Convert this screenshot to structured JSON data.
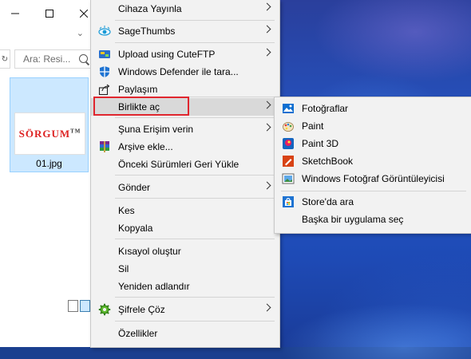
{
  "explorer": {
    "search_placeholder": "Ara: Resi...",
    "file_name": "01.jpg",
    "thumbnail_logo": "SÖRGUM",
    "thumbnail_logo_mark": "TM"
  },
  "context_menu": {
    "items": [
      {
        "label": "Cihaza Yayınla",
        "icon": "",
        "has_submenu": true
      },
      {
        "label": "SageThumbs",
        "icon": "eye-icon",
        "has_submenu": true
      },
      {
        "label": "Upload using CuteFTP",
        "icon": "cuteftp-icon",
        "has_submenu": true
      },
      {
        "label": "Windows Defender ile tara...",
        "icon": "defender-shield-icon",
        "has_submenu": false
      },
      {
        "label": "Paylaşım",
        "icon": "share-icon",
        "has_submenu": false
      },
      {
        "label": "Birlikte aç",
        "icon": "",
        "has_submenu": true,
        "highlighted": true
      },
      {
        "label": "Şuna Erişim verin",
        "icon": "",
        "has_submenu": true
      },
      {
        "label": "Arşive ekle...",
        "icon": "winrar-icon",
        "has_submenu": false
      },
      {
        "label": "Önceki Sürümleri Geri Yükle",
        "icon": "",
        "has_submenu": false
      },
      {
        "label": "Gönder",
        "icon": "",
        "has_submenu": true
      },
      {
        "label": "Kes",
        "icon": "",
        "has_submenu": false
      },
      {
        "label": "Kopyala",
        "icon": "",
        "has_submenu": false
      },
      {
        "label": "Kısayol oluştur",
        "icon": "",
        "has_submenu": false
      },
      {
        "label": "Sil",
        "icon": "",
        "has_submenu": false
      },
      {
        "label": "Yeniden adlandır",
        "icon": "",
        "has_submenu": false
      },
      {
        "label": "Şifrele  Çöz",
        "icon": "gear-icon",
        "has_submenu": true
      },
      {
        "label": "Özellikler",
        "icon": "",
        "has_submenu": false
      }
    ]
  },
  "open_with_submenu": {
    "items": [
      {
        "label": "Fotoğraflar",
        "icon": "photos-icon"
      },
      {
        "label": "Paint",
        "icon": "paint-icon"
      },
      {
        "label": "Paint 3D",
        "icon": "paint3d-icon"
      },
      {
        "label": "SketchBook",
        "icon": "sketchbook-icon"
      },
      {
        "label": "Windows Fotoğraf Görüntüleyicisi",
        "icon": "photo-viewer-icon"
      },
      {
        "label": "Store'da ara",
        "icon": "store-icon"
      },
      {
        "label": "Başka bir uygulama seç",
        "icon": ""
      }
    ]
  },
  "colors": {
    "highlight_box": "#e0262e",
    "menu_bg": "#f2f2f2",
    "selection": "#cce8ff"
  }
}
